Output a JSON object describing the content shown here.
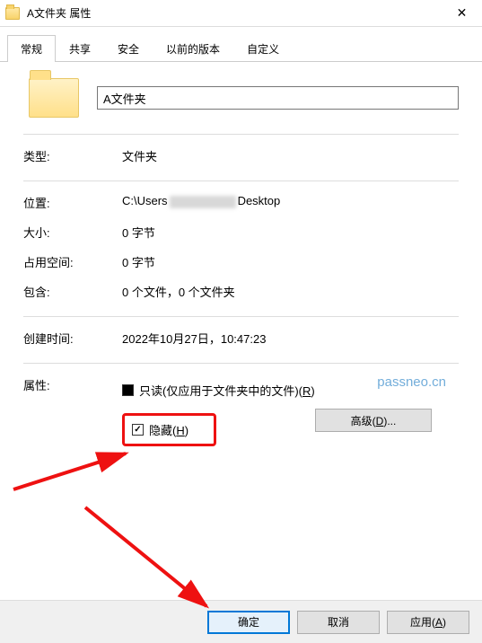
{
  "window": {
    "title": "A文件夹 属性"
  },
  "tabs": [
    "常规",
    "共享",
    "安全",
    "以前的版本",
    "自定义"
  ],
  "folder_name": "A文件夹",
  "fields": {
    "type_label": "类型:",
    "type_value": "文件夹",
    "location_label": "位置:",
    "location_prefix": "C:\\Users",
    "location_suffix": "Desktop",
    "size_label": "大小:",
    "size_value": "0 字节",
    "disk_label": "占用空间:",
    "disk_value": "0 字节",
    "contains_label": "包含:",
    "contains_value": "0 个文件，0 个文件夹",
    "created_label": "创建时间:",
    "created_value": "2022年10月27日，10:47:23",
    "attr_label": "属性:"
  },
  "attrs": {
    "readonly_label": "只读(仅应用于文件夹中的文件)(",
    "readonly_key": "R",
    "hidden_label": "隐藏(",
    "hidden_key": "H"
  },
  "buttons": {
    "advanced": "高级(",
    "advanced_key": "D",
    "ok": "确定",
    "cancel": "取消",
    "apply": "应用(",
    "apply_key": "A"
  },
  "watermark": "passneo.cn"
}
